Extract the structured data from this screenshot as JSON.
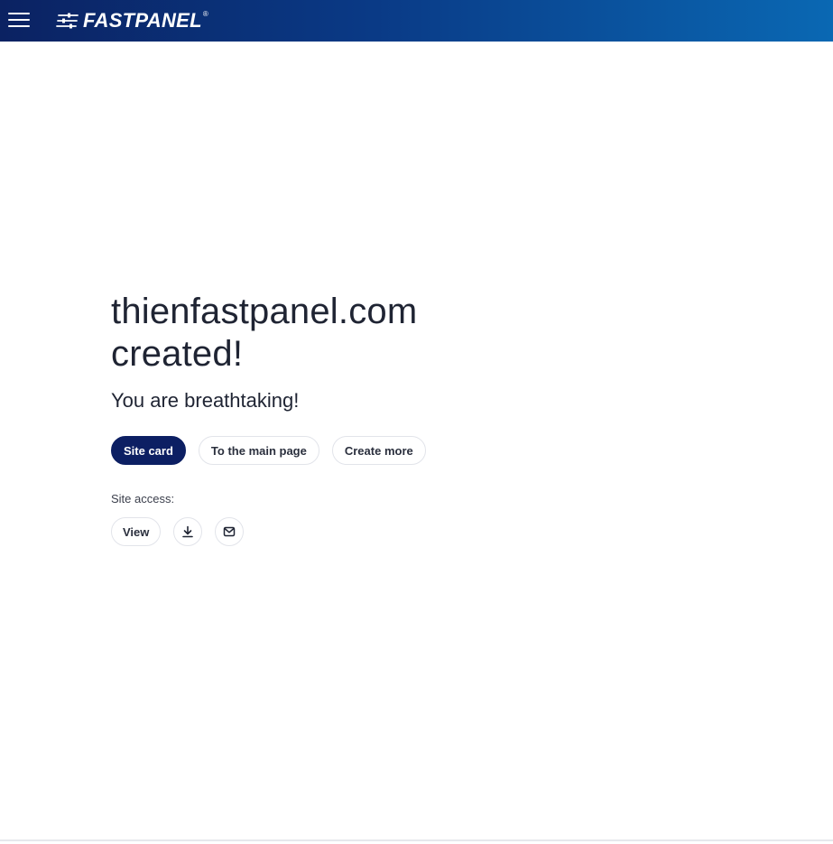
{
  "header": {
    "logo_text": "FASTPANEL",
    "logo_reg": "®",
    "colors": {
      "gradient_start": "#0b2262",
      "gradient_end": "#0a68b3"
    },
    "menu_icon": "hamburger-menu-icon"
  },
  "main": {
    "headline_line1": "thienfastpanel.com",
    "headline_line2": "created!",
    "subheadline": "You are breathtaking!",
    "buttons": {
      "site_card": "Site card",
      "main_page": "To the main page",
      "create_more": "Create more"
    },
    "site_access": {
      "label": "Site access:",
      "view_label": "View",
      "download_icon": "download-icon",
      "email_icon": "email-icon"
    },
    "colors": {
      "primary_button": "#0c1f63",
      "text": "#1f2433"
    }
  }
}
